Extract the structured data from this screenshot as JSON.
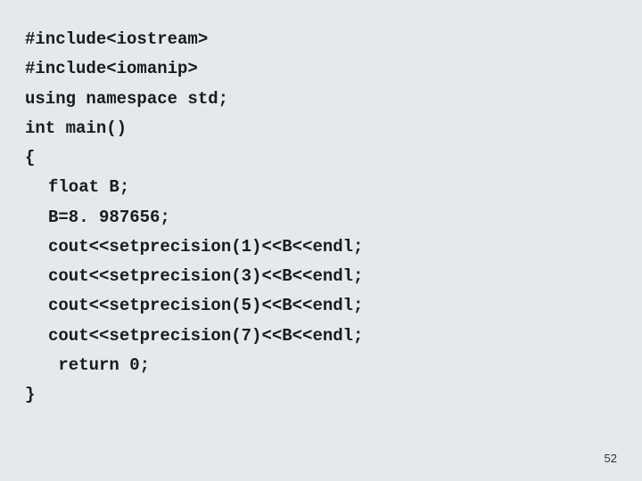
{
  "code": {
    "line1": "#include<iostream>",
    "line2": "#include<iomanip>",
    "line3": "using namespace std;",
    "line4": "int main()",
    "line5": "{",
    "line6": "float B;",
    "line7": "B=8. 987656;",
    "line8": "cout<<setprecision(1)<<B<<endl;",
    "line9": "cout<<setprecision(3)<<B<<endl;",
    "line10": "cout<<setprecision(5)<<B<<endl;",
    "line11": "cout<<setprecision(7)<<B<<endl;",
    "line12": " return 0;",
    "line13": "}"
  },
  "page_number": "52"
}
